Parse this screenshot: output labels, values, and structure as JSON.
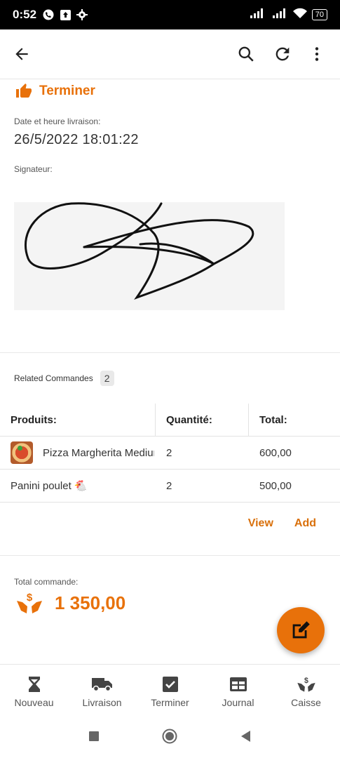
{
  "status_bar": {
    "time": "0:52",
    "battery": "70"
  },
  "app_bar": {
    "back_icon": "arrow-back-icon",
    "search_icon": "search-icon",
    "refresh_icon": "refresh-icon",
    "more_icon": "more-vert-icon"
  },
  "order": {
    "status_label": "Terminer",
    "delivery_label": "Date et heure livraison:",
    "delivery_value": "26/5/2022 18:01:22",
    "signer_label": "Signateur:",
    "related_label": "Related Commandes",
    "related_count": "2"
  },
  "table": {
    "headers": [
      "Produits:",
      "Quantité:",
      "Total:"
    ],
    "rows": [
      {
        "product": "Pizza Margherita Medium",
        "qty": "2",
        "total": "600,00"
      },
      {
        "product": "Panini poulet 🐔",
        "qty": "2",
        "total": "500,00"
      }
    ]
  },
  "actions": {
    "view": "View",
    "add": "Add"
  },
  "totals": {
    "label": "Total commande:",
    "amount": "1 350,00"
  },
  "bottom_nav": [
    {
      "label": "Nouveau",
      "icon": "hourglass-icon"
    },
    {
      "label": "Livraison",
      "icon": "truck-icon"
    },
    {
      "label": "Terminer",
      "icon": "checkbox-icon"
    },
    {
      "label": "Journal",
      "icon": "table-icon"
    },
    {
      "label": "Caisse",
      "icon": "money-hands-icon"
    }
  ],
  "colors": {
    "accent": "#e8710a"
  }
}
